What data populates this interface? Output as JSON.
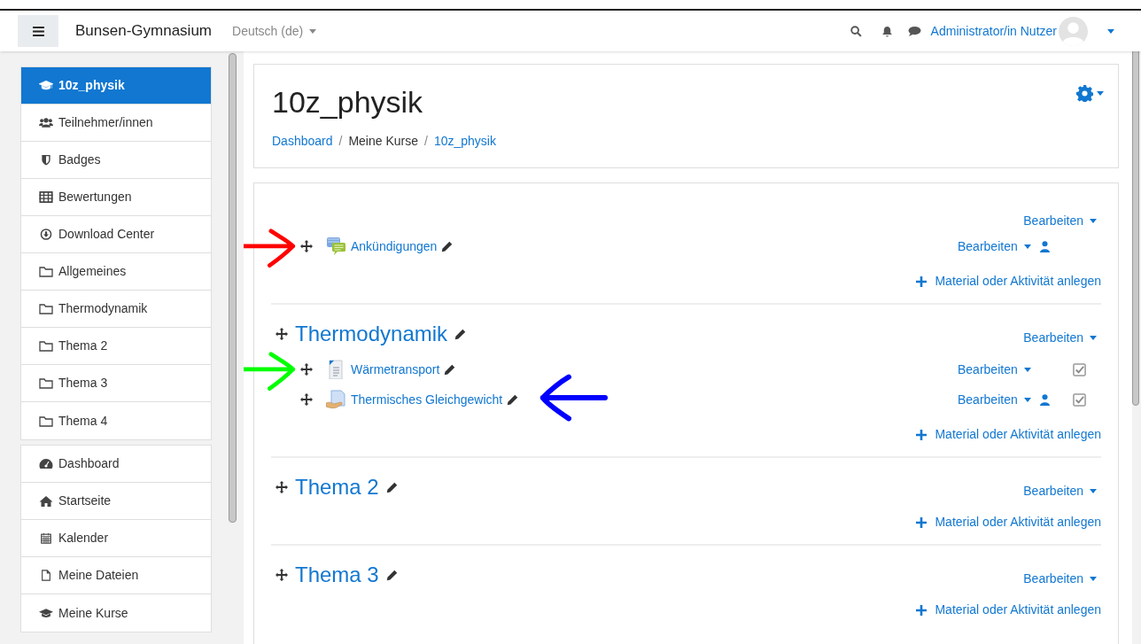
{
  "navbar": {
    "site_name": "Bunsen-Gymnasium",
    "language": "Deutsch (de)",
    "user_name": "Administrator/in Nutzer"
  },
  "sidebar": {
    "groups": [
      {
        "items": [
          {
            "kind": "course",
            "label": "10z_physik",
            "selected": true
          },
          {
            "kind": "participants",
            "label": "Teilnehmer/innen",
            "selected": false
          },
          {
            "kind": "badges",
            "label": "Badges",
            "selected": false
          },
          {
            "kind": "grades",
            "label": "Bewertungen",
            "selected": false
          },
          {
            "kind": "download",
            "label": "Download Center",
            "selected": false
          },
          {
            "kind": "section",
            "label": "Allgemeines",
            "selected": false
          },
          {
            "kind": "section",
            "label": "Thermodynamik",
            "selected": false
          },
          {
            "kind": "section",
            "label": "Thema 2",
            "selected": false
          },
          {
            "kind": "section",
            "label": "Thema 3",
            "selected": false
          },
          {
            "kind": "section",
            "label": "Thema 4",
            "selected": false
          }
        ]
      },
      {
        "items": [
          {
            "kind": "dashboard",
            "label": "Dashboard",
            "selected": false
          },
          {
            "kind": "home",
            "label": "Startseite",
            "selected": false
          },
          {
            "kind": "calendar",
            "label": "Kalender",
            "selected": false
          },
          {
            "kind": "files",
            "label": "Meine Dateien",
            "selected": false
          },
          {
            "kind": "courses",
            "label": "Meine Kurse",
            "selected": false
          }
        ]
      }
    ]
  },
  "header": {
    "title": "10z_physik",
    "breadcrumb": [
      {
        "kind": "link",
        "label": "Dashboard"
      },
      {
        "kind": "separator",
        "label": "/"
      },
      {
        "kind": "text",
        "label": "Meine Kurse"
      },
      {
        "kind": "separator",
        "label": "/"
      },
      {
        "kind": "link",
        "label": "10z_physik"
      }
    ]
  },
  "sections": [
    {
      "edit": "Bearbeiten",
      "activities": [
        {
          "kind": "forum",
          "name": "Ankündigungen",
          "edit": "Bearbeiten",
          "group_icon": true,
          "arrow": {
            "kind": "pointing-right",
            "color": "#ff0000"
          }
        }
      ],
      "add": "Material oder Aktivität anlegen"
    },
    {
      "title": "Thermodynamik",
      "edit": "Bearbeiten",
      "activities": [
        {
          "kind": "page",
          "name": "Wärmetransport",
          "edit": "Bearbeiten",
          "completed": true,
          "arrow": {
            "kind": "pointing-right",
            "color": "#00ff00"
          }
        },
        {
          "kind": "assignment",
          "name": "Thermisches Gleichgewicht",
          "edit": "Bearbeiten",
          "group_icon": true,
          "completed": true,
          "arrow": {
            "kind": "pointing-left",
            "color": "#0000ff"
          }
        }
      ],
      "add": "Material oder Aktivität anlegen"
    },
    {
      "title": "Thema 2",
      "edit": "Bearbeiten",
      "add": "Material oder Aktivität anlegen"
    },
    {
      "title": "Thema 3",
      "edit": "Bearbeiten",
      "add": "Material oder Aktivität anlegen"
    }
  ]
}
